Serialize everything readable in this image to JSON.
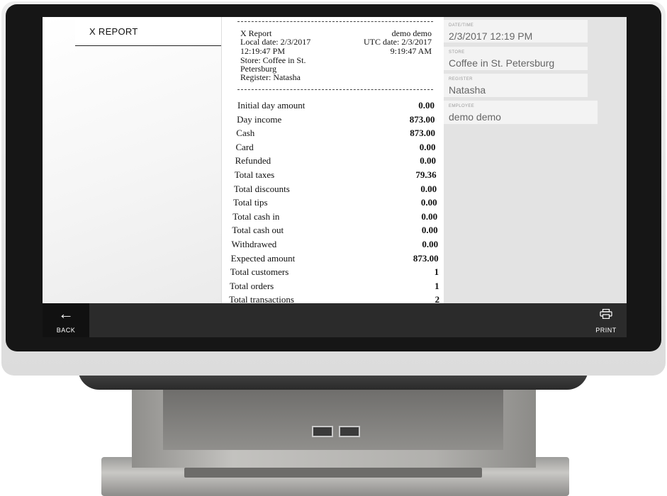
{
  "list": {
    "item_title": "X REPORT",
    "chevron": ">"
  },
  "receipt": {
    "title": "X Report",
    "employee": "demo demo",
    "local_date": "Local date: 2/3/2017",
    "utc_date": "UTC date: 2/3/2017",
    "local_time": "12:19:47 PM",
    "utc_time": "9:19:47 AM",
    "store_line1": "Store: Coffee in St.",
    "store_line2": "Petersburg",
    "register": "Register: Natasha",
    "rows": [
      {
        "label": "Initial day amount",
        "value": "0.00"
      },
      {
        "label": "Day income",
        "value": "873.00"
      },
      {
        "label": "Cash",
        "value": "873.00"
      },
      {
        "label": "Card",
        "value": "0.00"
      },
      {
        "label": "Refunded",
        "value": "0.00"
      },
      {
        "label": "Total taxes",
        "value": "79.36"
      },
      {
        "label": "Total discounts",
        "value": "0.00"
      },
      {
        "label": "Total tips",
        "value": "0.00"
      },
      {
        "label": "Total cash in",
        "value": "0.00"
      },
      {
        "label": "Total cash out",
        "value": "0.00"
      },
      {
        "label": "Withdrawed",
        "value": "0.00"
      },
      {
        "label": "Expected amount",
        "value": "873.00"
      },
      {
        "label": "Total customers",
        "value": "1"
      },
      {
        "label": "Total orders",
        "value": "1"
      },
      {
        "label": "Total transactions",
        "value": "2"
      }
    ]
  },
  "info": {
    "datetime": {
      "caption": "DATE/TIME",
      "value": "2/3/2017 12:19 PM"
    },
    "store": {
      "caption": "STORE",
      "value": "Coffee in St. Petersburg"
    },
    "register": {
      "caption": "REGISTER",
      "value": "Natasha"
    },
    "employee": {
      "caption": "EMPLOYEE",
      "value": "demo demo"
    }
  },
  "toolbar": {
    "back_label": "BACK",
    "back_icon": "←",
    "print_label": "PRINT"
  },
  "colors": {
    "toolbar": "#2b2b2b",
    "back_button": "#111111",
    "info_panel": "#e3e3e3"
  },
  "icons": [
    "arrow-left-icon",
    "printer-icon",
    "chevron-right-icon"
  ]
}
